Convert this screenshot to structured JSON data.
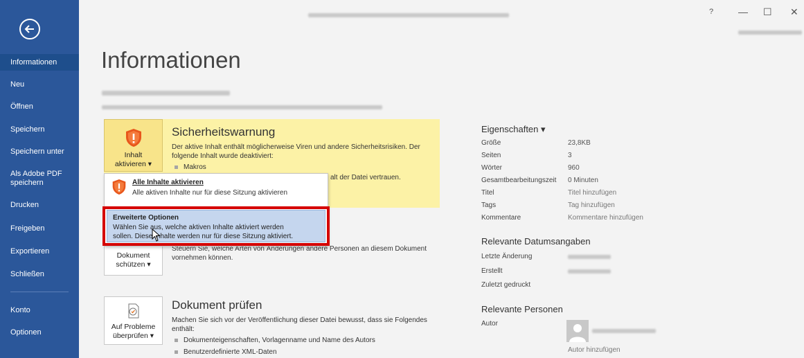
{
  "colors": {
    "sidebar": "#2b579a",
    "warning_bg": "#fcf2a6",
    "highlight": "#d50000"
  },
  "window": {
    "help": "?",
    "minimize": "—",
    "maximize": "☐",
    "close": "✕"
  },
  "sidebar": {
    "items": [
      {
        "label": "Informationen"
      },
      {
        "label": "Neu"
      },
      {
        "label": "Öffnen"
      },
      {
        "label": "Speichern"
      },
      {
        "label": "Speichern unter"
      },
      {
        "label": "Als Adobe PDF speichern"
      },
      {
        "label": "Drucken"
      },
      {
        "label": "Freigeben"
      },
      {
        "label": "Exportieren"
      },
      {
        "label": "Schließen"
      },
      {
        "label": "Konto"
      },
      {
        "label": "Optionen"
      }
    ]
  },
  "main": {
    "title": "Informationen",
    "security": {
      "button": {
        "line1": "Inhalt",
        "line2": "aktivieren ▾"
      },
      "heading": "Sicherheitswarnung",
      "text1": "Der aktive Inhalt enthält möglicherweise Viren und andere Sicherheitsrisiken. Der",
      "text2": "folgende Inhalt wurde deaktiviert:",
      "bullet": "Makros",
      "trust_text": "alt der Datei vertrauen."
    },
    "dropdown": {
      "opt1": {
        "title": "Alle Inhalte aktivieren",
        "desc": "Alle aktiven Inhalte nur für diese Sitzung aktivieren"
      },
      "opt2": {
        "title": "Erweiterte Optionen",
        "desc1": "Wählen Sie aus, welche aktiven Inhalte aktiviert werden",
        "desc2": "sollen. Diese Inhalte werden nur für diese Sitzung aktiviert."
      }
    },
    "protect": {
      "button": {
        "line1": "Dokument",
        "line2": "schützen ▾"
      },
      "text1": "Steuern Sie, welche Arten von Änderungen andere Personen an diesem Dokument",
      "text2": "vornehmen können."
    },
    "inspect": {
      "button": {
        "line1": "Auf Probleme",
        "line2": "überprüfen ▾"
      },
      "heading": "Dokument prüfen",
      "text1": "Machen Sie sich vor der Veröffentlichung dieser Datei bewusst, dass sie Folgendes",
      "text2": "enthält:",
      "bullets": [
        "Dokumenteigenschaften, Vorlagenname und Name des Autors",
        "Benutzerdefinierte XML-Daten"
      ]
    }
  },
  "properties": {
    "heading": "Eigenschaften ▾",
    "rows": [
      {
        "label": "Größe",
        "value": "23,8KB"
      },
      {
        "label": "Seiten",
        "value": "3"
      },
      {
        "label": "Wörter",
        "value": "960"
      },
      {
        "label": "Gesamtbearbeitungszeit",
        "value": "0 Minuten"
      },
      {
        "label": "Titel",
        "value": "Titel hinzufügen"
      },
      {
        "label": "Tags",
        "value": "Tag hinzufügen"
      },
      {
        "label": "Kommentare",
        "value": "Kommentare hinzufügen"
      }
    ],
    "dates_heading": "Relevante Datumsangaben",
    "dates": [
      {
        "label": "Letzte Änderung"
      },
      {
        "label": "Erstellt"
      },
      {
        "label": "Zuletzt gedruckt"
      }
    ],
    "people_heading": "Relevante Personen",
    "author_label": "Autor",
    "add_author": "Autor hinzufügen"
  }
}
